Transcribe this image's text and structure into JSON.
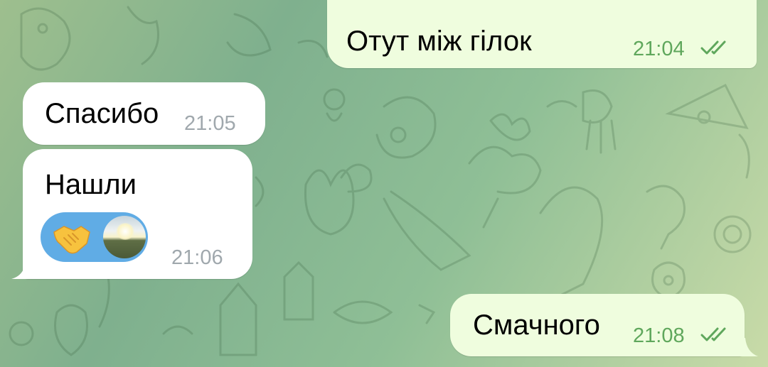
{
  "messages": [
    {
      "text": "Отут між гілок",
      "time": "21:04",
      "direction": "outgoing",
      "status": "read"
    },
    {
      "text": "Спасибо",
      "time": "21:05",
      "direction": "incoming"
    },
    {
      "text": "Нашли",
      "time": "21:06",
      "direction": "incoming",
      "reactions": [
        {
          "icon": "handshake-icon"
        }
      ]
    },
    {
      "text": "Смачного",
      "time": "21:08",
      "direction": "outgoing",
      "status": "read"
    }
  ],
  "colors": {
    "outgoing_bubble": "#effdde",
    "incoming_bubble": "#ffffff",
    "outgoing_time": "#5fa75c",
    "incoming_time": "#a0a8ad",
    "reaction_pill": "#60ace5"
  }
}
